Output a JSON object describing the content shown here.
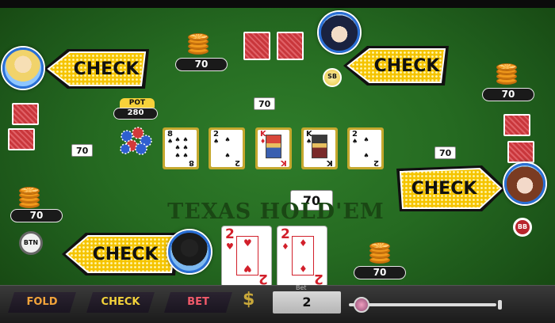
{
  "table": {
    "watermark": "TEXAS HOLD'EM",
    "pot_label": "POT",
    "pot_value": "280",
    "center_bet": "70",
    "hero_bet": "70"
  },
  "colors": {
    "felt": "#256a21",
    "chip": "#f19a1c",
    "banner_yellow": "#f5c400",
    "avatar_ring": "#2a6fd6",
    "board_frame": "#c5a82e",
    "card_red": "#d2202b"
  },
  "players": {
    "left_top": {
      "action": "CHECK",
      "bet": "70",
      "chip_bet": "70"
    },
    "top_right": {
      "action": "CHECK",
      "bet": "70",
      "badge": "SB"
    },
    "right": {
      "action": "CHECK",
      "bet": "70",
      "chip_bet": "70",
      "badge": "BB"
    },
    "left_bottom": {
      "bet": "70",
      "badge": "BTN"
    },
    "hero": {
      "action": "CHECK",
      "bet": "70"
    }
  },
  "board": [
    {
      "rank": "8",
      "suit": "♠",
      "color": "black"
    },
    {
      "rank": "2",
      "suit": "♠",
      "color": "black"
    },
    {
      "rank": "K",
      "suit": "♦",
      "color": "red"
    },
    {
      "rank": "K",
      "suit": "♠",
      "color": "black"
    },
    {
      "rank": "2",
      "suit": "♠",
      "color": "black"
    }
  ],
  "hero_cards": [
    {
      "rank": "2",
      "suit": "♥"
    },
    {
      "rank": "2",
      "suit": "♦"
    }
  ],
  "controls": {
    "fold": "FOLD",
    "check": "CHECK",
    "bet": "BET",
    "currency_icon": "$",
    "bet_label": "Bet",
    "bet_amount": "2"
  }
}
